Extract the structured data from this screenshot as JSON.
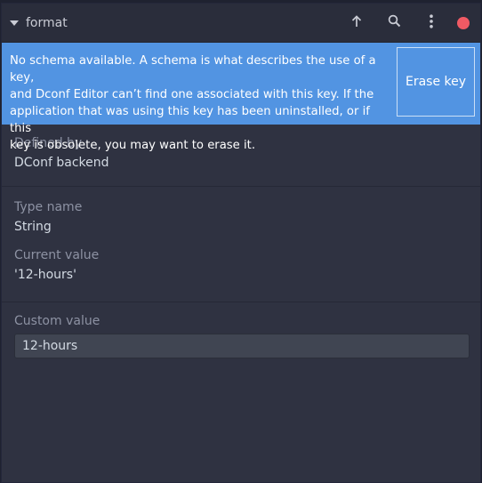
{
  "header": {
    "title": "format",
    "title_menu_icon": "pan-down-triangle-icon",
    "up_icon": "go-up-arrow-icon",
    "search_icon": "search-icon",
    "menu_icon": "vertical-ellipsis-icon",
    "close_icon": "close-circle-icon"
  },
  "infobar": {
    "message_lines": [
      "No schema available. A schema is what describes the use of a key,",
      "and Dconf Editor can’t find one associated with this key. If the",
      "application that was using this key has been uninstalled, or if this",
      "key is obsolete, you may want to erase it."
    ],
    "erase_label": "Erase key"
  },
  "properties": {
    "defined_by_label": "Defined by",
    "defined_by_value": "DConf backend",
    "type_name_label": "Type name",
    "type_name_value": "String",
    "current_value_label": "Current value",
    "current_value_value": "'12-hours'",
    "custom_value_label": "Custom value",
    "custom_value_input": "12-hours"
  },
  "colors": {
    "window_bg": "#2f3241",
    "header_bg": "#2a2d3b",
    "infobar_bg": "#5294e2",
    "close_button": "#f05a64",
    "label_text": "#8d92a3",
    "value_text": "#d3dae3"
  }
}
